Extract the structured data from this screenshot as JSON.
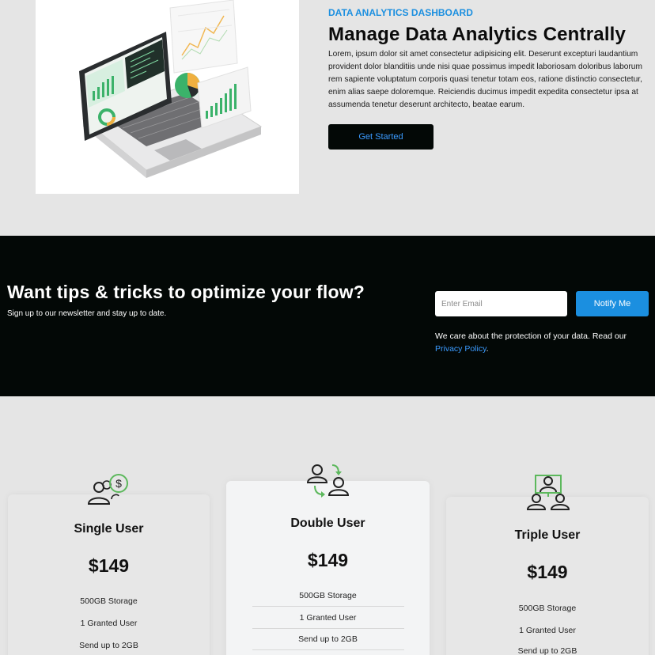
{
  "hero": {
    "eyebrow": "DATA ANALYTICS DASHBOARD",
    "title": "Manage Data Analytics Centrally",
    "body": "Lorem, ipsum dolor sit amet consectetur adipisicing elit. Deserunt excepturi laudantium provident dolor blanditiis unde nisi quae possimus impedit laboriosam doloribus laborum rem sapiente voluptatum corporis quasi tenetur totam eos, ratione distinctio consectetur, enim alias saepe doloremque. Reiciendis ducimus impedit expedita consectetur ipsa at assumenda tenetur deserunt architecto, beatae earum.",
    "cta_label": "Get Started",
    "illustration_icon": "laptop-analytics-illustration"
  },
  "newsletter": {
    "title": "Want tips & tricks to optimize your flow?",
    "subtitle": "Sign up to our newsletter and stay up to date.",
    "email_placeholder": "Enter Email",
    "notify_label": "Notify Me",
    "note_prefix": "We care about the protection of your data. Read our ",
    "privacy_link": "Privacy Policy",
    "note_suffix": "."
  },
  "pricing": {
    "plans": [
      {
        "name": "Single User",
        "price": "$149",
        "icon": "user-dollar-icon",
        "features": [
          "500GB Storage",
          "1 Granted User",
          "Send up to 2GB"
        ]
      },
      {
        "name": "Double User",
        "price": "$149",
        "icon": "users-swap-icon",
        "features": [
          "500GB Storage",
          "1 Granted User",
          "Send up to 2GB"
        ]
      },
      {
        "name": "Triple User",
        "price": "$149",
        "icon": "users-group-icon",
        "features": [
          "500GB Storage",
          "1 Granted User",
          "Send up to 2GB"
        ]
      }
    ]
  },
  "colors": {
    "accent": "#1b8fe0",
    "dark": "#030806",
    "page_bg": "#e5e5e5",
    "icon_green": "#5cb85c"
  }
}
